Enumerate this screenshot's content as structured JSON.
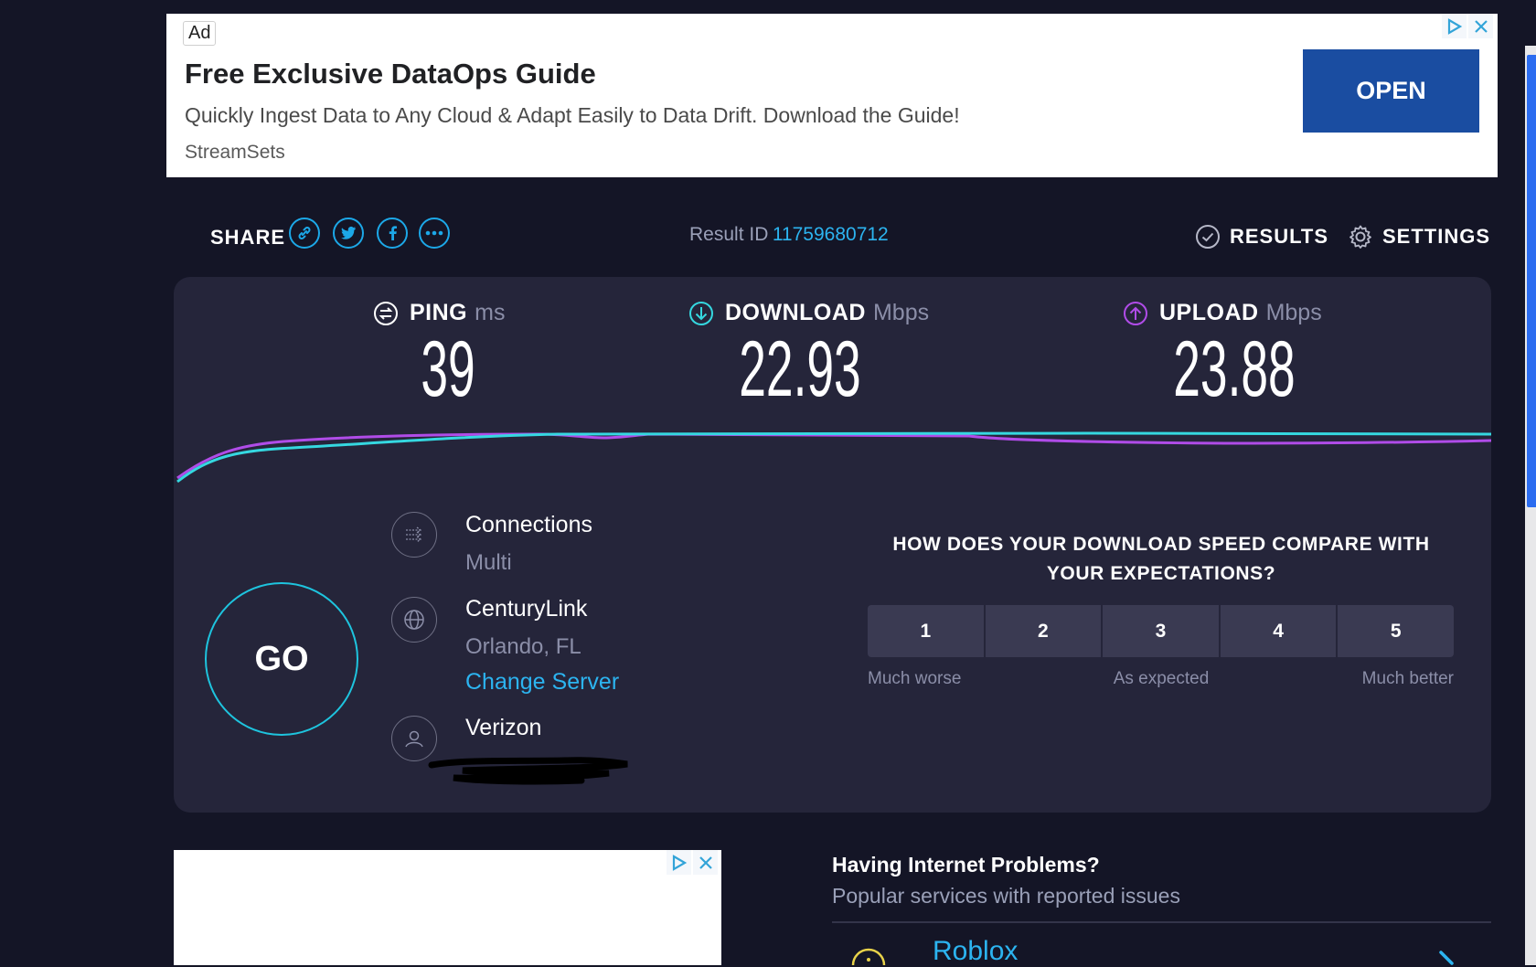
{
  "top_ad": {
    "badge": "Ad",
    "title": "Free Exclusive DataOps Guide",
    "description": "Quickly Ingest Data to Any Cloud & Adapt Easily to Data Drift. Download the Guide!",
    "source": "StreamSets",
    "cta": "OPEN",
    "adchoices_icon": "adchoices-icon",
    "close_icon": "close-icon"
  },
  "header": {
    "share_label": "SHARE",
    "share_icons": [
      "link-icon",
      "twitter-icon",
      "facebook-icon",
      "more-icon"
    ],
    "result_label": "Result ID",
    "result_id": "11759680712",
    "results_label": "RESULTS",
    "settings_label": "SETTINGS"
  },
  "metrics": {
    "ping": {
      "label": "PING",
      "unit": "ms",
      "value": "39"
    },
    "download": {
      "label": "DOWNLOAD",
      "unit": "Mbps",
      "value": "22.93"
    },
    "upload": {
      "label": "UPLOAD",
      "unit": "Mbps",
      "value": "23.88"
    }
  },
  "go_label": "GO",
  "connection": {
    "connections_label": "Connections",
    "connections_value": "Multi",
    "server_name": "CenturyLink",
    "server_location": "Orlando, FL",
    "change_server": "Change Server",
    "isp": "Verizon"
  },
  "survey": {
    "question_line1": "HOW DOES YOUR DOWNLOAD SPEED COMPARE WITH",
    "question_line2": "YOUR EXPECTATIONS?",
    "options": [
      "1",
      "2",
      "3",
      "4",
      "5"
    ],
    "scale_low": "Much worse",
    "scale_mid": "As expected",
    "scale_high": "Much better"
  },
  "problems": {
    "title": "Having Internet Problems?",
    "subtitle": "Popular services with reported issues",
    "first_service": "Roblox"
  },
  "colors": {
    "background": "#141526",
    "panel": "#25253a",
    "accent_blue": "#2cb4f0",
    "download_line": "#35d8e0",
    "upload_line": "#b04ce8"
  }
}
